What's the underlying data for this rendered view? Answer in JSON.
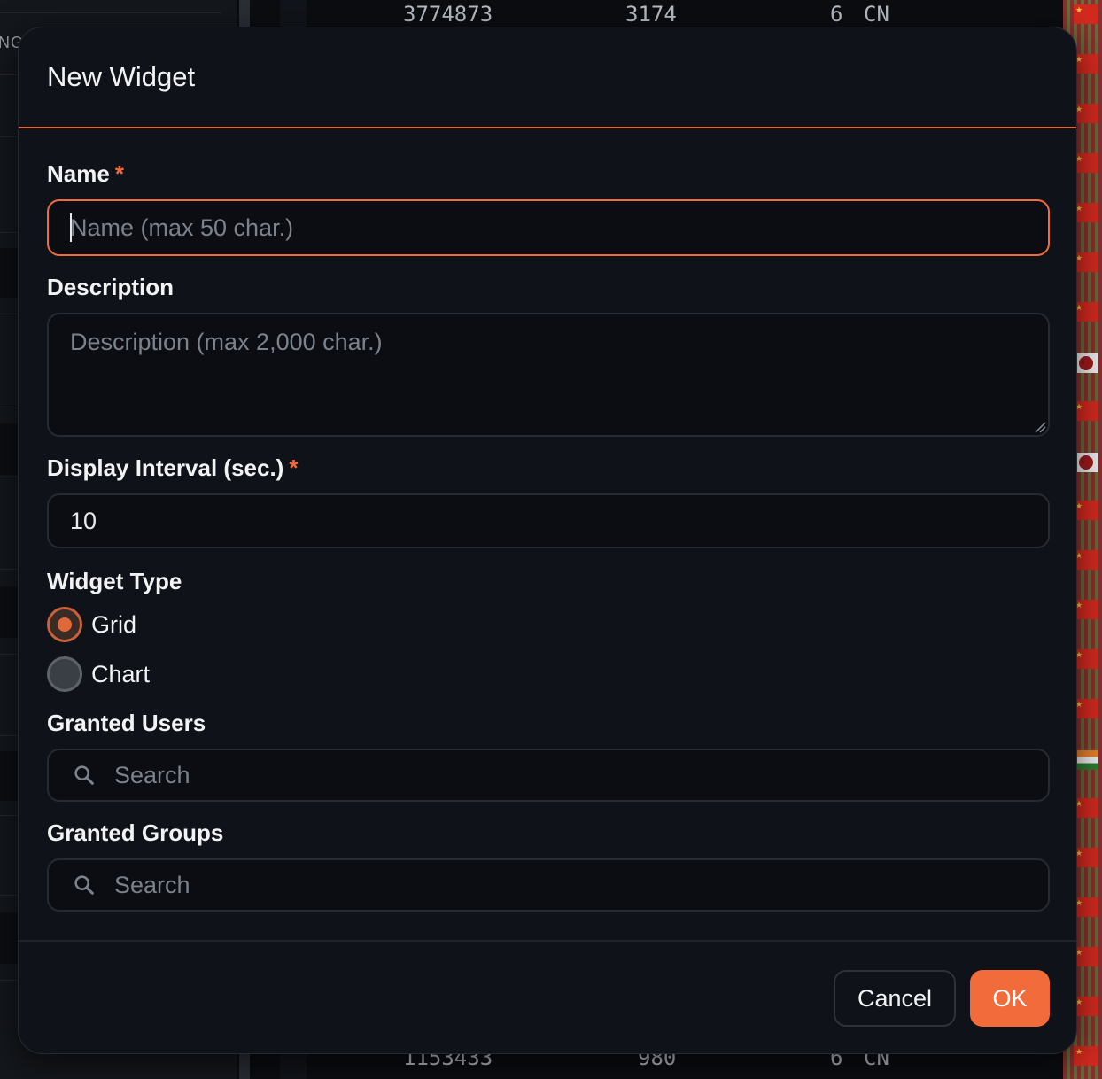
{
  "background": {
    "left_fragment": "NG",
    "top_row": {
      "col1": "3774873",
      "col2": "3174",
      "col3": "6",
      "col4": "CN"
    },
    "bottom_row": {
      "col1": "1153433",
      "col2": "980",
      "col3": "6",
      "col4": "CN"
    }
  },
  "modal": {
    "title": "New Widget",
    "name": {
      "label": "Name",
      "required_mark": "*",
      "placeholder": "Name (max 50 char.)",
      "value": ""
    },
    "description": {
      "label": "Description",
      "placeholder": "Description (max 2,000 char.)",
      "value": ""
    },
    "interval": {
      "label": "Display Interval (sec.)",
      "required_mark": "*",
      "value": "10"
    },
    "widget_type": {
      "label": "Widget Type",
      "options": [
        {
          "label": "Grid",
          "checked": true
        },
        {
          "label": "Chart",
          "checked": false
        }
      ]
    },
    "granted_users": {
      "label": "Granted Users",
      "placeholder": "Search",
      "icon": "search-icon"
    },
    "granted_groups": {
      "label": "Granted Groups",
      "placeholder": "Search",
      "icon": "search-icon"
    },
    "buttons": {
      "cancel": "Cancel",
      "ok": "OK"
    }
  },
  "colors": {
    "accent": "#f26b3a",
    "surface": "#0f1218",
    "field_bg": "#0b0d12"
  }
}
